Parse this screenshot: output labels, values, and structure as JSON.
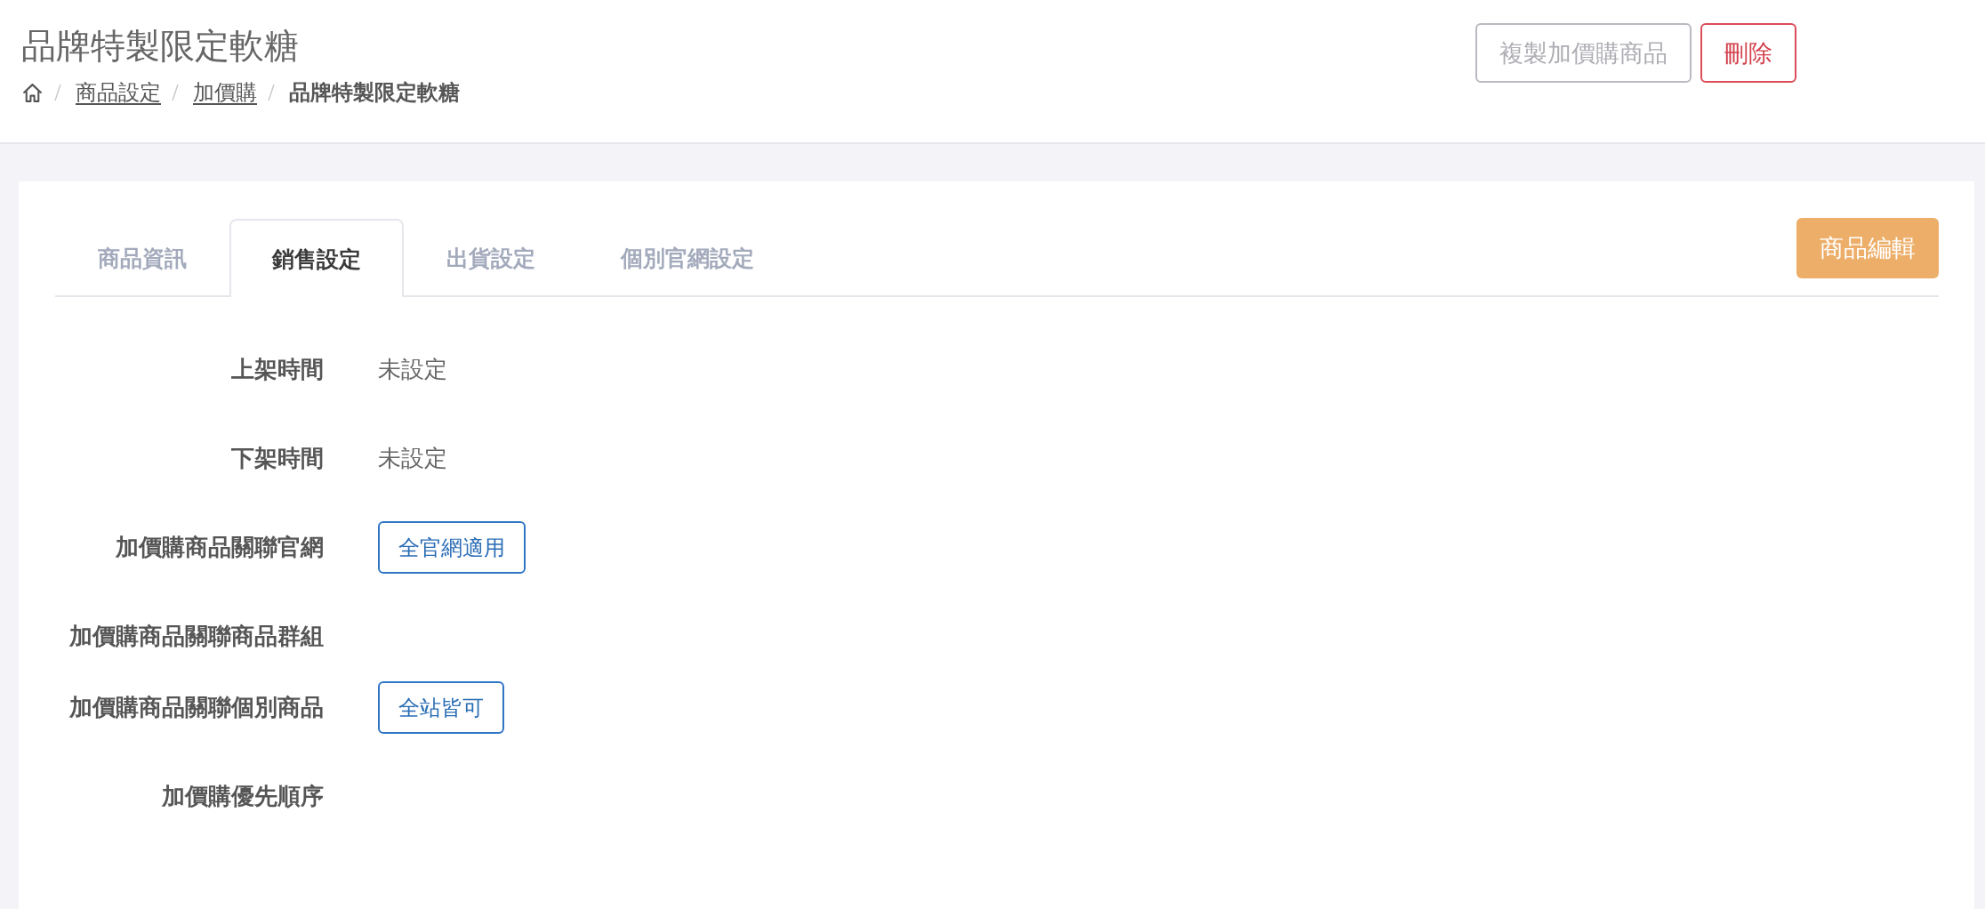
{
  "page_header": {
    "title": "品牌特製限定軟糖",
    "breadcrumb": [
      {
        "label": "商品設定",
        "kind": "link"
      },
      {
        "label": "加價購",
        "kind": "link"
      },
      {
        "label": "品牌特製限定軟糖",
        "kind": "current"
      }
    ],
    "actions": [
      {
        "label": "複製加價購商品",
        "kind": "secondary"
      },
      {
        "label": "刪除",
        "kind": "danger"
      }
    ]
  },
  "tabs": [
    {
      "label": "商品資訊",
      "selected": false
    },
    {
      "label": "銷售設定",
      "selected": true
    },
    {
      "label": "出貨設定",
      "selected": false
    },
    {
      "label": "個別官網設定",
      "selected": false
    }
  ],
  "edit_button": {
    "label": "商品編輯"
  },
  "fields": [
    {
      "label": "上架時間",
      "value": {
        "kind": "text",
        "text": "未設定"
      }
    },
    {
      "label": "下架時間",
      "value": {
        "kind": "text",
        "text": "未設定"
      }
    },
    {
      "label": "加價購商品關聯官網",
      "value": {
        "kind": "button",
        "text": "全官網適用"
      }
    },
    {
      "label": "加價購商品關聯商品群組"
    },
    {
      "label": "加價購商品關聯個別商品",
      "value": {
        "kind": "button",
        "text": "全站皆可"
      }
    },
    {
      "label": "加價購優先順序"
    }
  ]
}
